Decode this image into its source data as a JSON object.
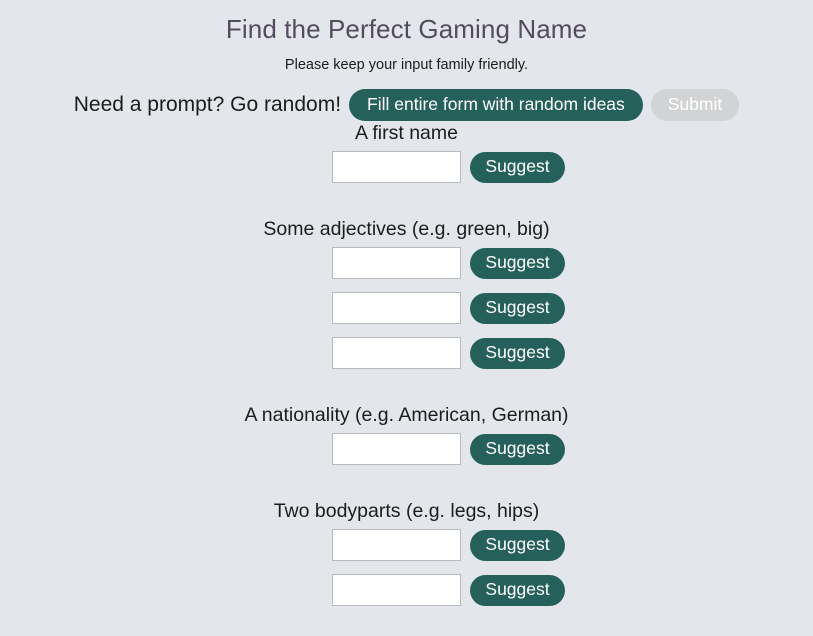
{
  "header": {
    "title": "Find the Perfect Gaming Name",
    "subtitle": "Please keep your input family friendly."
  },
  "random": {
    "prompt_text": "Need a prompt? Go random!",
    "fill_button_label": "Fill entire form with random ideas",
    "submit_button_label": "Submit",
    "submit_disabled": true
  },
  "colors": {
    "page_background": "#e3e7ec",
    "title": "#554b5e",
    "accent_teal": "#26605a",
    "disabled_gray": "#d2d3d4",
    "input_border": "#b6b9bd",
    "input_background": "#ffffff",
    "text": "#1c1c1c"
  },
  "suggest_label": "Suggest",
  "fields": [
    {
      "label": "A first name",
      "inputs": [
        {
          "value": "",
          "placeholder": ""
        }
      ]
    },
    {
      "label": "Some adjectives (e.g. green, big)",
      "inputs": [
        {
          "value": "",
          "placeholder": ""
        },
        {
          "value": "",
          "placeholder": ""
        },
        {
          "value": "",
          "placeholder": ""
        }
      ]
    },
    {
      "label": "A nationality (e.g. American, German)",
      "inputs": [
        {
          "value": "",
          "placeholder": ""
        }
      ]
    },
    {
      "label": "Two bodyparts (e.g. legs, hips)",
      "inputs": [
        {
          "value": "",
          "placeholder": ""
        },
        {
          "value": "",
          "placeholder": ""
        }
      ]
    }
  ]
}
